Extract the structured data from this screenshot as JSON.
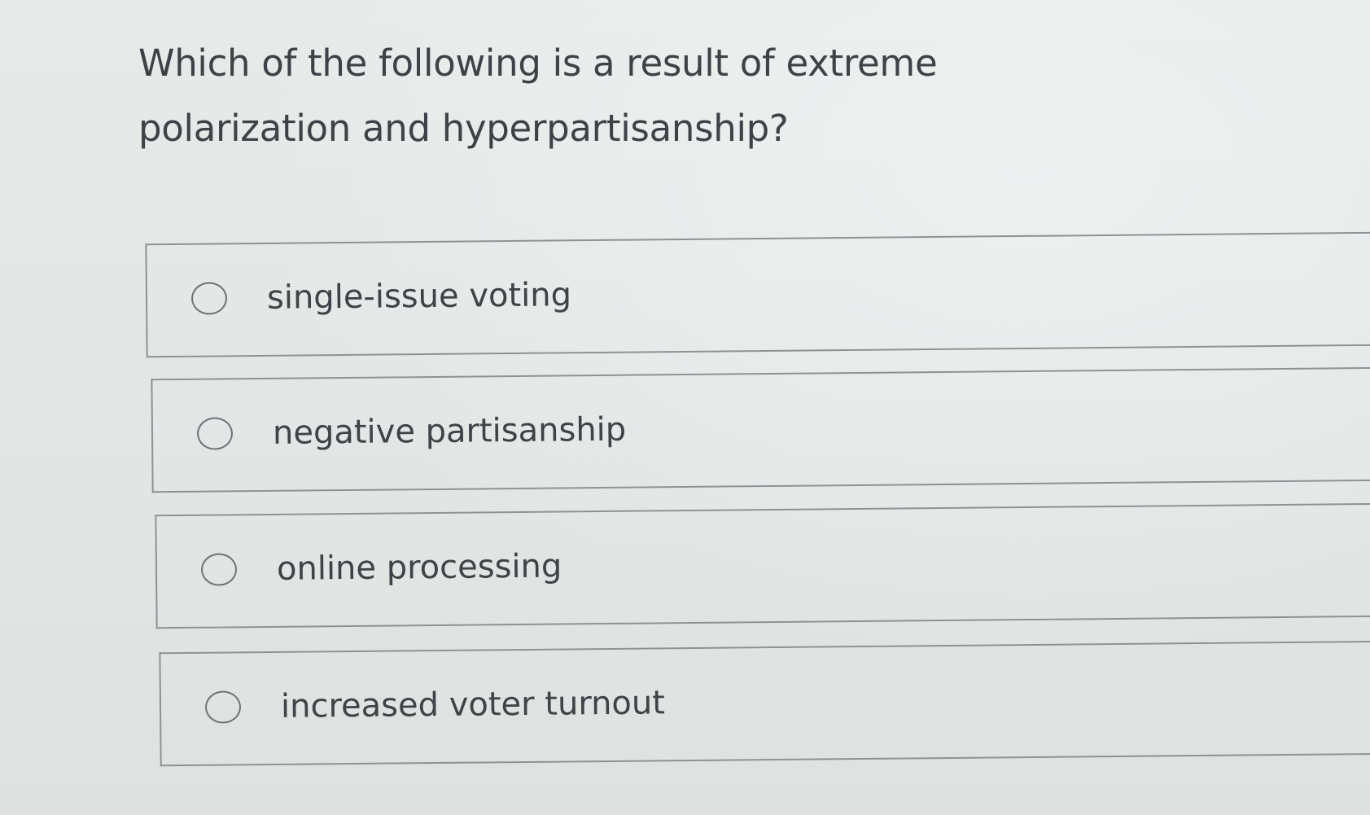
{
  "question": {
    "text": "Which of the following is a result of extreme polarization and hyperpartisanship?"
  },
  "choices": [
    {
      "label": "single-issue voting",
      "selected": false
    },
    {
      "label": "negative partisanship",
      "selected": false
    },
    {
      "label": "online processing",
      "selected": false
    },
    {
      "label": "increased voter turnout",
      "selected": false
    }
  ],
  "colors": {
    "background": "#e4e8e7",
    "text": "#3d4247",
    "border": "#8d9294"
  }
}
